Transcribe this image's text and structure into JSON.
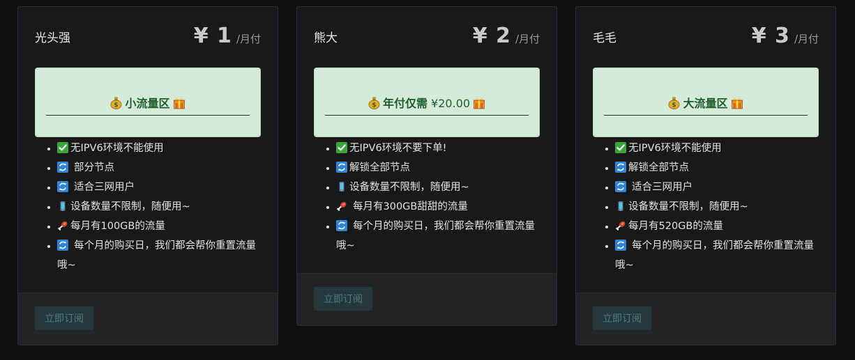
{
  "plans": [
    {
      "name": "光头强",
      "price": "¥ 1",
      "period": "/月付",
      "banner": "小流量区",
      "features": [
        {
          "icon": "check-icon",
          "text": "无IPV6环境不能使用"
        },
        {
          "icon": "refresh-icon",
          "text": "部分节点"
        },
        {
          "icon": "refresh-icon",
          "text": "适合三网用户"
        },
        {
          "icon": "phone-icon",
          "text": "设备数量不限制，随便用~"
        },
        {
          "icon": "drumstick-icon",
          "text": "每月有100GB的流量"
        },
        {
          "icon": "refresh-icon",
          "text": "每个月的购买日，我们都会帮你重置流量哦~"
        }
      ],
      "button": "立即订阅"
    },
    {
      "name": "熊大",
      "price": "¥ 2",
      "period": "/月付",
      "banner_bold": "年付仅需",
      "banner_plain": "¥20.00",
      "features": [
        {
          "icon": "check-icon",
          "text": "无IPV6环境不要下单!"
        },
        {
          "icon": "refresh-icon",
          "text": "解锁全部节点"
        },
        {
          "icon": "phone-icon",
          "text": "设备数量不限制，随便用~"
        },
        {
          "icon": "drumstick-icon",
          "text": "每月有300GB甜甜的流量"
        },
        {
          "icon": "refresh-icon",
          "text": "每个月的购买日，我们都会帮你重置流量哦~"
        }
      ],
      "button": "立即订阅"
    },
    {
      "name": "毛毛",
      "price": "¥ 3",
      "period": "/月付",
      "banner": "大流量区",
      "features": [
        {
          "icon": "check-icon",
          "text": "无IPV6环境不能使用"
        },
        {
          "icon": "refresh-icon",
          "text": "解锁全部节点"
        },
        {
          "icon": "refresh-icon",
          "text": "适合三网用户"
        },
        {
          "icon": "phone-icon",
          "text": "设备数量不限制，随便用~"
        },
        {
          "icon": "drumstick-icon",
          "text": "每月有520GB的流量"
        },
        {
          "icon": "refresh-icon",
          "text": "每个月的购买日，我们都会帮你重置流量哦~"
        }
      ],
      "button": "立即订阅"
    }
  ],
  "colors": {
    "page_bg": "#0f0f11",
    "card_bg": "#19191c",
    "banner_bg": "#d4ebd9",
    "banner_text": "#1f5d2e",
    "button_bg": "#25383c",
    "button_text": "#4f7c80"
  }
}
